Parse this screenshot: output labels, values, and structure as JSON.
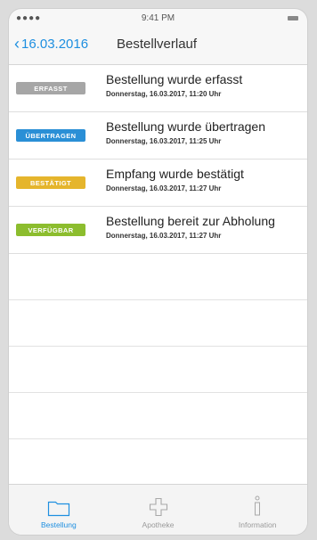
{
  "status": {
    "signal": "●●●● ",
    "time": "9:41 PM"
  },
  "nav": {
    "back_label": "16.03.2016",
    "title": "Bestellverlauf"
  },
  "entries": [
    {
      "badge": "ERFASST",
      "badge_color": "#a6a6a6",
      "title": "Bestellung wurde erfasst",
      "subtitle": "Donnerstag, 16.03.2017, 11:20 Uhr"
    },
    {
      "badge": "ÜBERTRAGEN",
      "badge_color": "#2a8fd6",
      "title": "Bestellung wurde übertragen",
      "subtitle": "Donnerstag, 16.03.2017, 11:25 Uhr"
    },
    {
      "badge": "BESTÄTIGT",
      "badge_color": "#e5b52c",
      "title": "Empfang wurde bestätigt",
      "subtitle": "Donnerstag, 16.03.2017, 11:27 Uhr"
    },
    {
      "badge": "VERFÜGBAR",
      "badge_color": "#8cbd2e",
      "title": "Bestellung bereit zur Abholung",
      "subtitle": "Donnerstag, 16.03.2017, 11:27 Uhr"
    }
  ],
  "tabs": [
    {
      "label": "Bestellung",
      "icon": "folder-icon",
      "active": true
    },
    {
      "label": "Apotheke",
      "icon": "pharmacy-cross-icon",
      "active": false
    },
    {
      "label": "Information",
      "icon": "info-icon",
      "active": false
    }
  ]
}
